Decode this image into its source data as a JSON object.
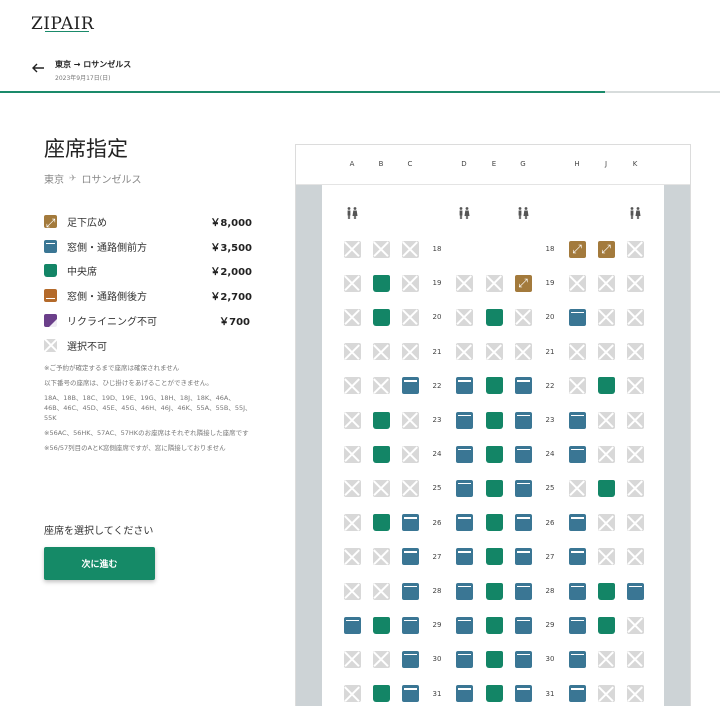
{
  "brand": {
    "logo": "ZIPAIR"
  },
  "header": {
    "route": "東京 → ロサンゼルス",
    "date": "2023年9月17日(日)",
    "progress": 0.84
  },
  "main": {
    "title": "座席指定",
    "from": "東京",
    "to": "ロサンゼルス",
    "legend": [
      {
        "type": "leg",
        "label": "足下広め",
        "price": "￥8,000",
        "color": "#a37a3c"
      },
      {
        "type": "win",
        "label": "窓側・通路側前方",
        "price": "￥3,500",
        "color": "#3a7694"
      },
      {
        "type": "mid",
        "label": "中央席",
        "price": "￥2,000",
        "color": "#138566"
      },
      {
        "type": "rear",
        "label": "窓側・通路側後方",
        "price": "￥2,700",
        "color": "#b46a2a"
      },
      {
        "type": "norec",
        "label": "リクライニング不可",
        "price": "￥700",
        "color": "#6b3f8a"
      },
      {
        "type": "na",
        "label": "選択不可",
        "price": "",
        "color": "#d8d8d8"
      }
    ],
    "notes": [
      "※ご予約が確定するまで座席は確保されません",
      "以下番号の座席は、ひじ掛けをあげることができません。",
      "18A、18B、18C、19D、19E、19G、18H、18J、18K、46A、46B、46C、45D、45E、45G、46H、46J、46K、55A、55B、55J、55K",
      "※56AC、56HK、57AC、57HKのお座席はそれぞれ隣接した座席です",
      "※56/57列目のAとK窓側座席ですが、窓に隣接しておりません"
    ],
    "select_prompt": "座席を選択してください",
    "next_label": "次に進む"
  },
  "seatmap": {
    "columns": [
      "A",
      "B",
      "C",
      "D",
      "E",
      "G",
      "H",
      "J",
      "K"
    ],
    "rows": [
      {
        "num": "18",
        "seats": [
          "na",
          "na",
          "na",
          "",
          "",
          "",
          "leg",
          "leg",
          "na"
        ]
      },
      {
        "num": "19",
        "seats": [
          "na",
          "mid",
          "na",
          "na",
          "na",
          "leg",
          "na",
          "na",
          "na"
        ]
      },
      {
        "num": "20",
        "seats": [
          "na",
          "mid",
          "na",
          "na",
          "mid",
          "na",
          "win",
          "na",
          "na"
        ]
      },
      {
        "num": "21",
        "seats": [
          "na",
          "na",
          "na",
          "na",
          "na",
          "na",
          "na",
          "na",
          "na"
        ]
      },
      {
        "num": "22",
        "seats": [
          "na",
          "na",
          "win",
          "win",
          "mid",
          "win",
          "na",
          "mid",
          "na"
        ]
      },
      {
        "num": "23",
        "seats": [
          "na",
          "mid",
          "na",
          "win",
          "mid",
          "win",
          "win",
          "na",
          "na"
        ]
      },
      {
        "num": "24",
        "seats": [
          "na",
          "mid",
          "na",
          "win",
          "mid",
          "win",
          "win",
          "na",
          "na"
        ]
      },
      {
        "num": "25",
        "seats": [
          "na",
          "na",
          "na",
          "win",
          "mid",
          "win",
          "na",
          "mid",
          "na"
        ]
      },
      {
        "num": "26",
        "seats": [
          "na",
          "mid",
          "win",
          "win",
          "mid",
          "win",
          "win",
          "na",
          "na"
        ]
      },
      {
        "num": "27",
        "seats": [
          "na",
          "na",
          "win",
          "win",
          "mid",
          "win",
          "win",
          "na",
          "na"
        ]
      },
      {
        "num": "28",
        "seats": [
          "na",
          "na",
          "win",
          "win",
          "mid",
          "win",
          "win",
          "mid",
          "win"
        ]
      },
      {
        "num": "29",
        "seats": [
          "win",
          "mid",
          "win",
          "win",
          "mid",
          "win",
          "win",
          "mid",
          "na"
        ]
      },
      {
        "num": "30",
        "seats": [
          "na",
          "na",
          "win",
          "win",
          "mid",
          "win",
          "win",
          "na",
          "na"
        ]
      },
      {
        "num": "31",
        "seats": [
          "na",
          "mid",
          "win",
          "win",
          "mid",
          "win",
          "win",
          "na",
          "na"
        ]
      }
    ]
  }
}
